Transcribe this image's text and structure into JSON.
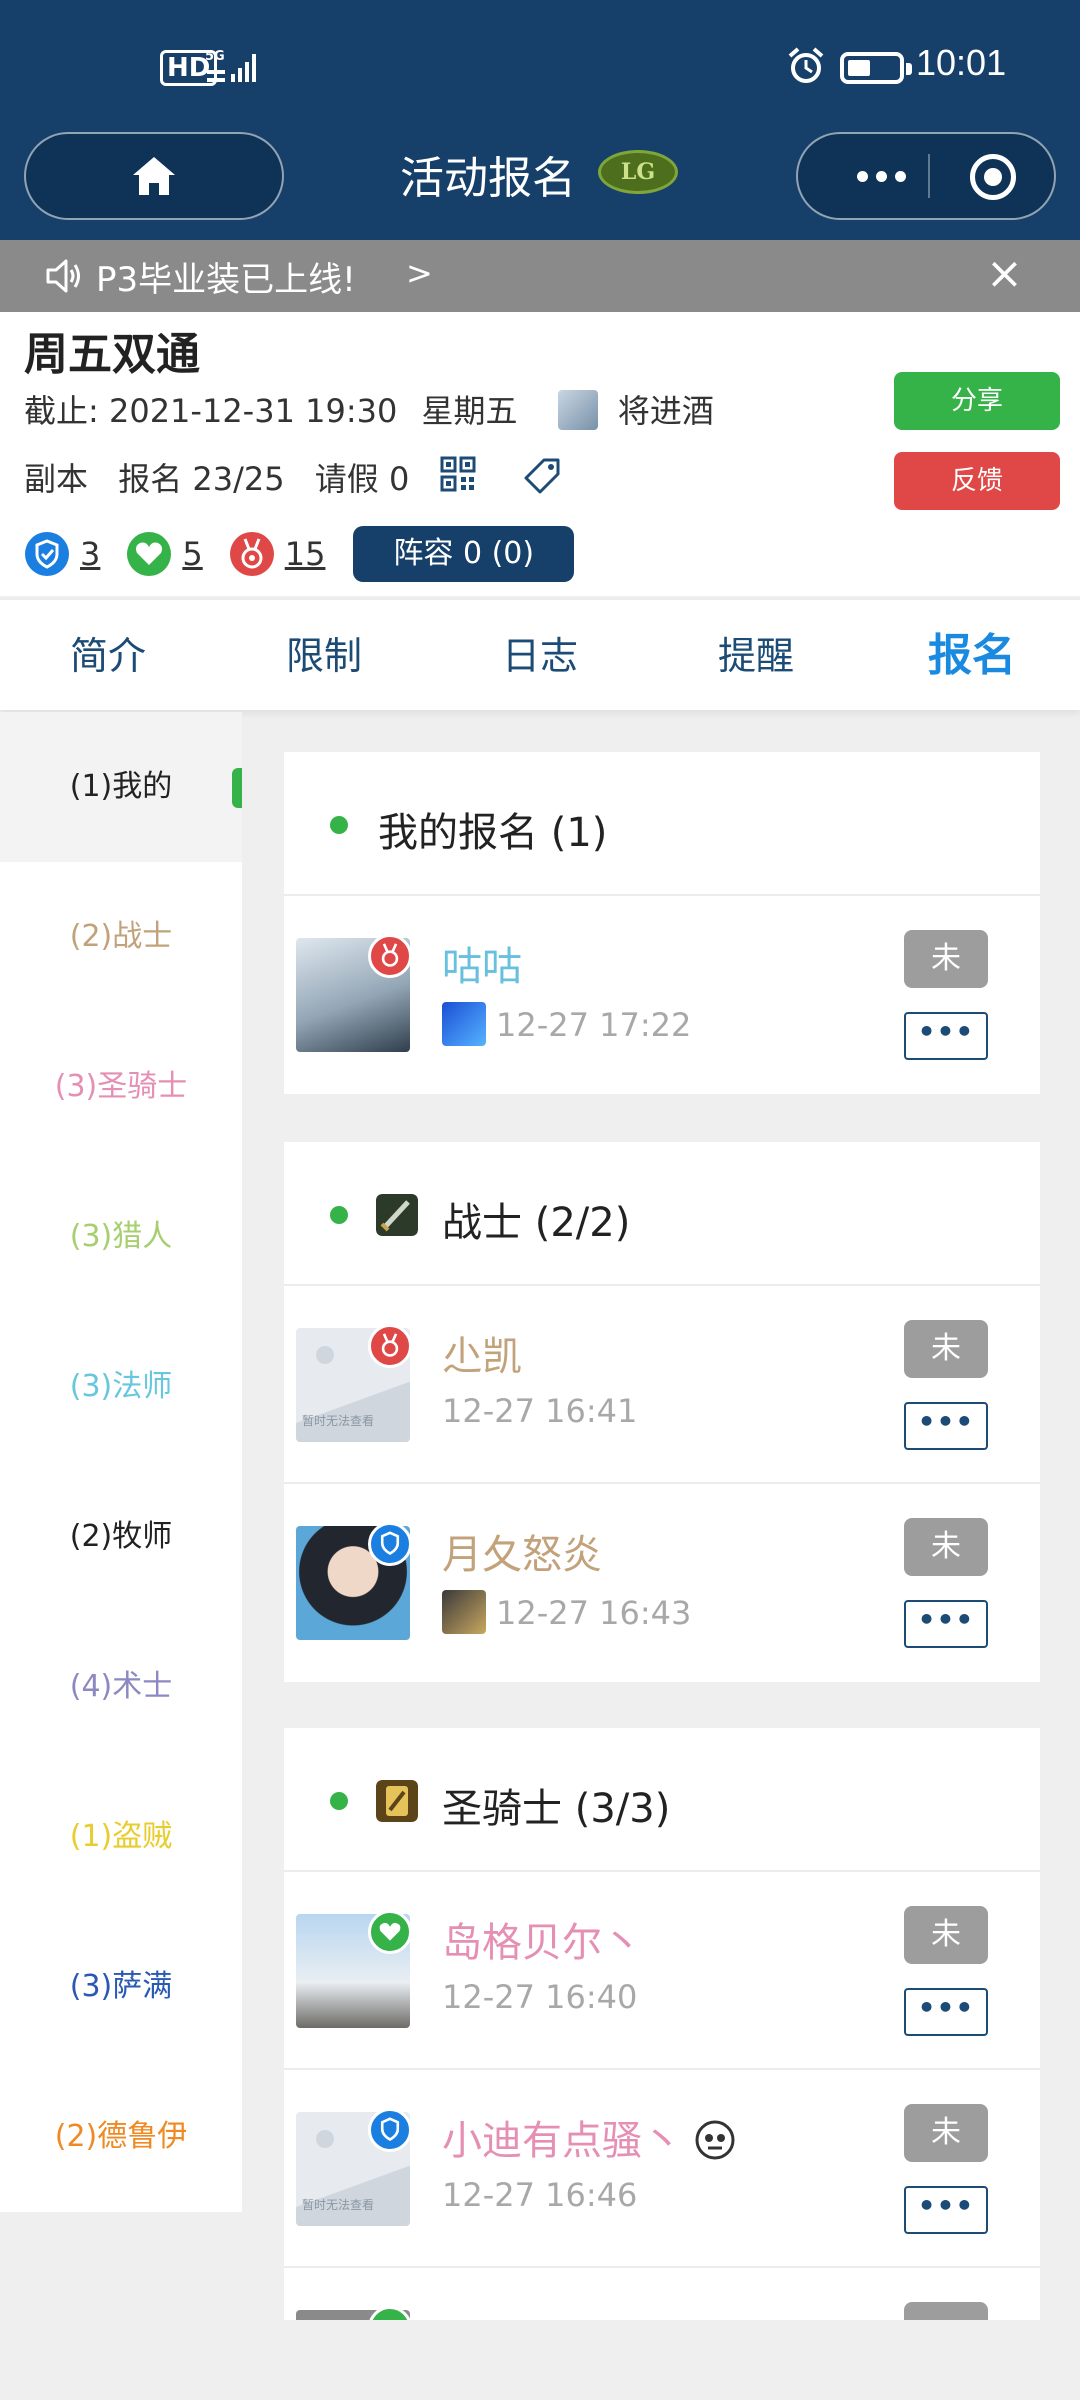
{
  "status": {
    "hd": "HD",
    "network": "5G",
    "time": "10:01"
  },
  "header": {
    "title": "活动报名",
    "badge_text": "LG"
  },
  "notice": {
    "text": "P3毕业装已上线!",
    "arrow": ">"
  },
  "event": {
    "title": "周五双通",
    "deadline_label": "截止:",
    "deadline": "2021-12-31 19:30",
    "weekday": "星期五",
    "author": "将进酒",
    "type": "副本",
    "signup": "报名 23/25",
    "leave": "请假 0",
    "share_label": "分享",
    "feedback_label": "反馈",
    "tank_count": "3",
    "healer_count": "5",
    "dps_count": "15",
    "lineup_label": "阵容 0 (0)"
  },
  "tabs": [
    "简介",
    "限制",
    "日志",
    "提醒",
    "报名"
  ],
  "active_tab": "报名",
  "sidebar": [
    {
      "label": "(1)我的",
      "color": "#222222"
    },
    {
      "label": "(2)战士",
      "color": "#c2a27a"
    },
    {
      "label": "(3)圣骑士",
      "color": "#e58fb4"
    },
    {
      "label": "(3)猎人",
      "color": "#a7cf70"
    },
    {
      "label": "(3)法师",
      "color": "#66c7de"
    },
    {
      "label": "(2)牧师",
      "color": "#222222"
    },
    {
      "label": "(4)术士",
      "color": "#8c88c2"
    },
    {
      "label": "(1)盗贼",
      "color": "#e9cc2e"
    },
    {
      "label": "(3)萨满",
      "color": "#2a59b3"
    },
    {
      "label": "(2)德鲁伊",
      "color": "#ef8a22"
    }
  ],
  "sections": {
    "mine": {
      "label": "我的报名 (1)",
      "members": [
        {
          "name": "咕咕",
          "time": "12-27 17:22",
          "status": "未",
          "more": "•••",
          "name_color": "#66c0de"
        }
      ]
    },
    "warrior": {
      "label": "战士 (2/2)",
      "members": [
        {
          "name": "尐凯",
          "time": "12-27 16:41",
          "status": "未",
          "more": "•••",
          "name_color": "#c2a27a"
        },
        {
          "name": "月夂怒炎",
          "time": "12-27 16:43",
          "status": "未",
          "more": "•••",
          "name_color": "#c2a27a"
        }
      ]
    },
    "paladin": {
      "label": "圣骑士 (3/3)",
      "members": [
        {
          "name": "岛格贝尔丶",
          "time": "12-27 16:40",
          "status": "未",
          "more": "•••",
          "name_color": "#e58fb4"
        },
        {
          "name": "小迪有点骚丶",
          "time": "12-27 16:46",
          "status": "未",
          "more": "•••",
          "name_color": "#e58fb4"
        }
      ]
    }
  },
  "placeholder_text": "暂时无法查看"
}
